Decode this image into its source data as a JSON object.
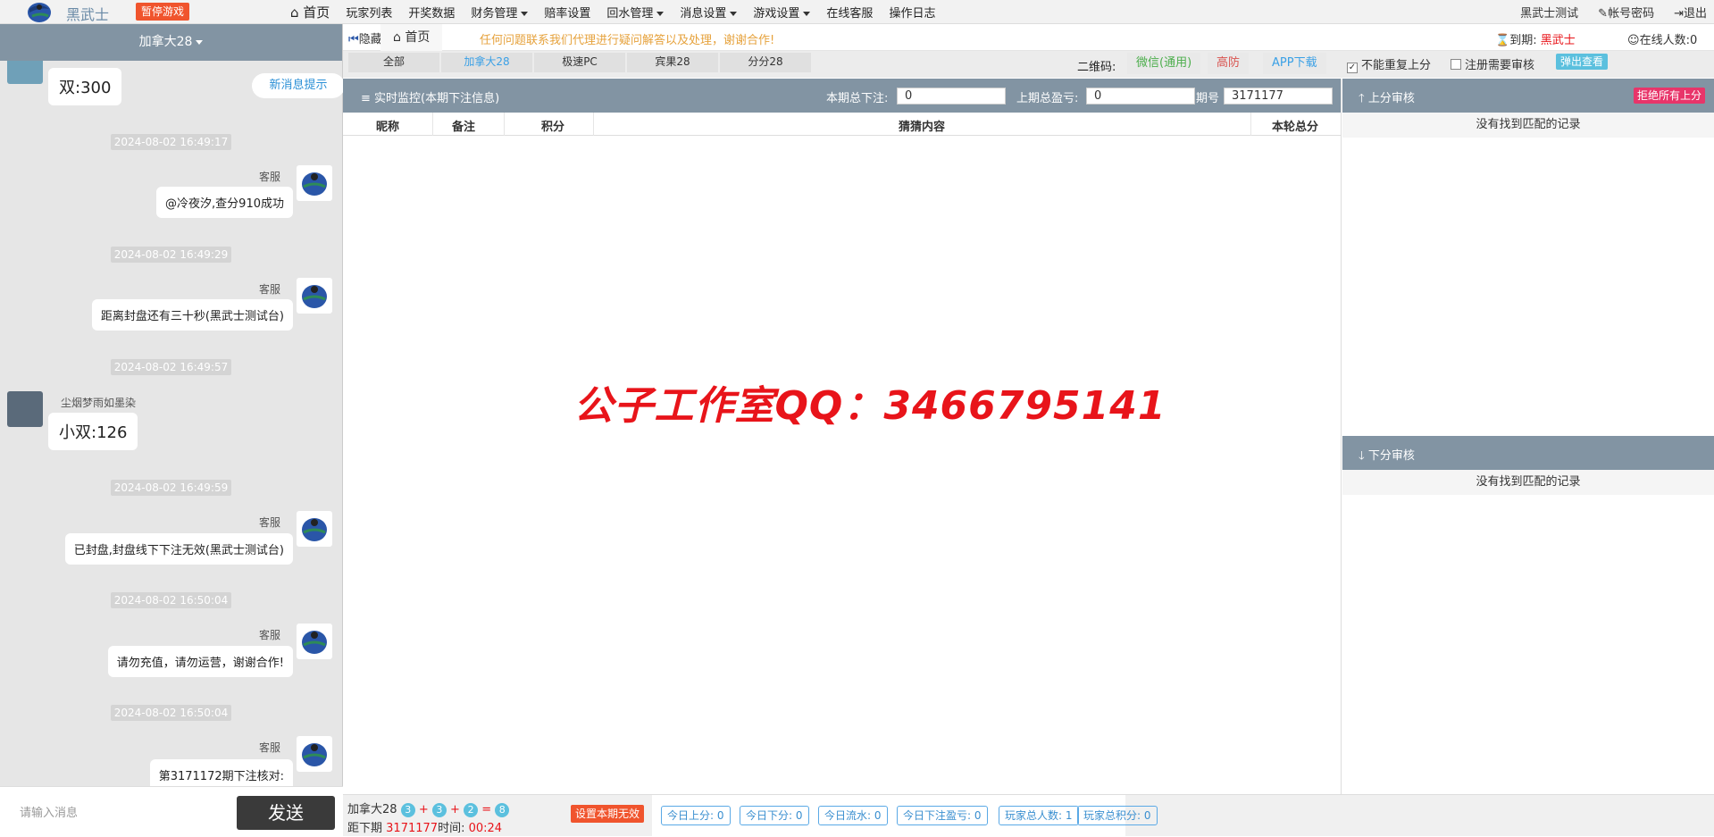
{
  "topbar": {
    "brand": "黑武士",
    "pause_game": "暂停游戏",
    "nav": [
      "首页",
      "玩家列表",
      "开奖数据",
      "财务管理",
      "赔率设置",
      "回水管理",
      "消息设置",
      "游戏设置",
      "在线客服",
      "操作日志"
    ],
    "user": "黑武士测试",
    "account_password": "帐号密码",
    "logout": "退出"
  },
  "left": {
    "game_title": "加拿大28",
    "new_message_tip": "新消息提示",
    "input_placeholder": "请输入消息",
    "send": "发送",
    "messages": [
      {
        "text": "双:300"
      },
      {
        "time": "2024-08-02 16:49:17",
        "sender": "客服",
        "text": "@冷夜汐,查分910成功"
      },
      {
        "time": "2024-08-02 16:49:29",
        "sender": "客服",
        "text": "距离封盘还有三十秒(黑武士测试台)"
      },
      {
        "time": "2024-08-02 16:49:57",
        "sender": "尘烟梦雨如墨染",
        "text": "小双:126"
      },
      {
        "time": "2024-08-02 16:49:59",
        "sender": "客服",
        "text": "已封盘,封盘线下下注无效(黑武士测试台)"
      },
      {
        "time": "2024-08-02 16:50:04",
        "sender": "客服",
        "text": "请勿充值，请勿运营，谢谢合作!"
      },
      {
        "time": "2024-08-02 16:50:04",
        "sender": "客服",
        "text": "第3171172期下注核对:"
      }
    ]
  },
  "main": {
    "hide": "隐藏",
    "home_tab": "首页",
    "notice": "任何问题联系我们代理进行疑问解答以及处理，谢谢合作!",
    "subtabs": [
      "全部",
      "加拿大28",
      "极速PC",
      "宾果28",
      "分分28"
    ],
    "qr_label": "二维码:",
    "wechat": "微信(通用)",
    "high_defense": "高防",
    "app_download": "APP下载",
    "no_repeat_checked": "✓",
    "no_repeat": "不能重复上分",
    "register_review": "注册需要审核",
    "popup_view": "弹出查看",
    "expire_label": "到期:",
    "expire_value": "黑武士",
    "online_label": "在线人数:",
    "online_count": "0",
    "monitor": {
      "title": "实时监控(本期下注信息)",
      "total_bet_label": "本期总下注:",
      "total_bet": "0",
      "last_profit_label": "上期总盈亏:",
      "last_profit": "0",
      "period_label": "期号",
      "period": "3171177",
      "columns": [
        "昵称",
        "备注",
        "积分",
        "猜猜内容",
        "本轮总分"
      ],
      "watermark": "公子工作室QQ：3466795141"
    },
    "up_review": {
      "title": "上分审核",
      "reject_all": "拒绝所有上分",
      "empty": "没有找到匹配的记录"
    },
    "down_review": {
      "title": "下分审核",
      "empty": "没有找到匹配的记录"
    },
    "bottom": {
      "game": "加拿大28",
      "n1": "3",
      "plus1": "+",
      "n2": "3",
      "plus2": "+",
      "n3": "2",
      "eq": "=",
      "sum": "8",
      "next_label": "距下期",
      "next_period": "3171177",
      "time_label": "时间:",
      "time": "00:24",
      "set_invalid": "设置本期无效",
      "stats": [
        "今日上分: 0",
        "今日下分: 0",
        "今日流水: 0",
        "今日下注盈亏: 0",
        "玩家总人数: 1",
        "玩家总积分: 0"
      ]
    }
  },
  "colors": {
    "header_bg": "#8294a3",
    "accent_red": "#f0542d",
    "link_blue": "#3aa0e6",
    "watermark_red": "#e8141a"
  }
}
